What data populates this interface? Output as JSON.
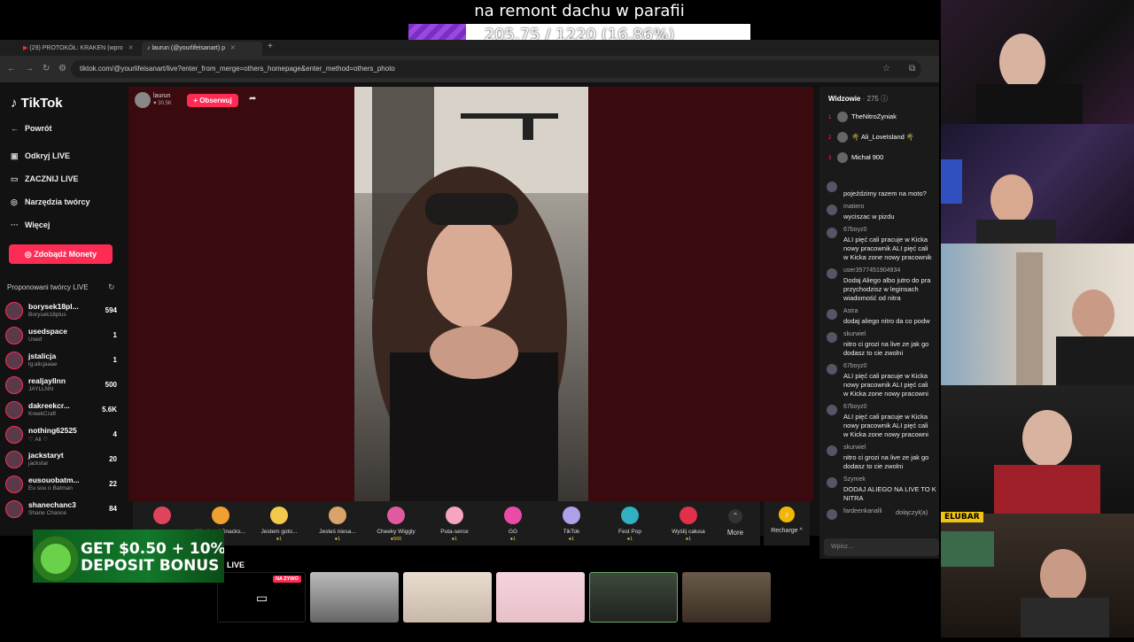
{
  "overlay": {
    "goal_title": "na remont dachu w parafii",
    "goal_text": "205.75 / 1220 (16.86%)",
    "goal_fraction": 0.1686,
    "goal_fill_color": "#8e3fd6"
  },
  "browser": {
    "tabs": [
      "(29) PROTOKÓŁ: KRAKEN (wpro",
      "laurun (@yourlifeisanart) p"
    ],
    "url": "tiktok.com/@yourlifeisanart/live?enter_from_merge=others_homepage&enter_method=others_photo"
  },
  "tiktok": {
    "logo": "TikTok",
    "nav": {
      "back": "Powrót",
      "explore": "Odkryj LIVE",
      "go_live": "ZACZNIJ LIVE",
      "creator_tools": "Narzędzia twórcy",
      "more": "Więcej"
    },
    "get_coins": "Zdobądź Monety",
    "suggested_header": "Proponowani twórcy LIVE",
    "creators": [
      {
        "name": "borysek18pl...",
        "sub": "Borysek18plus",
        "count": "594"
      },
      {
        "name": "usedspace",
        "sub": "Used",
        "count": "1"
      },
      {
        "name": "jstalicja",
        "sub": "lg:alicjaaae",
        "count": "1"
      },
      {
        "name": "realjayllnn",
        "sub": "JAYLLNN",
        "count": "500"
      },
      {
        "name": "dakreekcr...",
        "sub": "KreekCraft",
        "count": "5.6K"
      },
      {
        "name": "nothing62525",
        "sub": "♡ Ali ♡",
        "count": "4"
      },
      {
        "name": "jackstaryt",
        "sub": "jackstar",
        "count": "20"
      },
      {
        "name": "eusouobatm...",
        "sub": "Eu sou o Batman",
        "count": "22"
      },
      {
        "name": "shanechanc3",
        "sub": "Shane Chance",
        "count": "84"
      }
    ],
    "host": {
      "name": "laurun",
      "likes": "30.5K",
      "follow": "+ Obserwuj"
    },
    "gifts": [
      {
        "name": "",
        "price": "1",
        "color": "#e0445a"
      },
      {
        "name": "Weekend Snacks...",
        "price": "1",
        "color": "#f0a030"
      },
      {
        "name": "Jestem goto...",
        "price": "1",
        "color": "#f2c94c"
      },
      {
        "name": "Jesteś niesa...",
        "price": "1",
        "color": "#d9a36b"
      },
      {
        "name": "Cheeky Wiggly",
        "price": "500",
        "color": "#e05aa0"
      },
      {
        "name": "Puta-serce",
        "price": "1",
        "color": "#f5a5c0"
      },
      {
        "name": "GG",
        "price": "1",
        "color": "#e94ba8"
      },
      {
        "name": "TikTok",
        "price": "1",
        "color": "#b0a0e8"
      },
      {
        "name": "Fest Pop",
        "price": "1",
        "color": "#30b0c0"
      },
      {
        "name": "Wyślij całusa",
        "price": "1",
        "color": "#e0304a"
      }
    ],
    "more": "More",
    "recharge": "Recharge ^",
    "viewers_label": "Widzowie",
    "viewers_count": "· 275",
    "top_viewers": [
      {
        "rank": "1",
        "name": "TheNitroZyniak"
      },
      {
        "rank": "2",
        "name": "🌴 Ali_LoveIsland 🌴"
      },
      {
        "rank": "3",
        "name": "Michał 900"
      }
    ],
    "chat": [
      {
        "user": "",
        "text": "pojeździmy razem na moto?"
      },
      {
        "user": "matiero",
        "text": "wyciszac w pizdu"
      },
      {
        "user": "67boyz0",
        "text": "ALI pięć cali pracuje w Kicka\nnowy pracownik ALI pięć cali\nw Kicka zone nowy pracownik"
      },
      {
        "user": "user3577451904934",
        "text": "Dodaj Aliego albo jutro do pra\nprzychodzisz w leginsach\nwiadomość od nitra"
      },
      {
        "user": "Astra",
        "text": "dodaj aliego nitro da co podw"
      },
      {
        "user": "skurwiel",
        "text": "nitro ci grozi na live ze jak go\ndodasz to cie zwolni"
      },
      {
        "user": "67boyz0",
        "text": "ALI pięć cali pracuje w Kicka\nnowy pracownik ALI pięć cali\nw Kicka zone nowy pracowni"
      },
      {
        "user": "67boyz0",
        "text": "ALI pięć cali pracuje w Kicka\nnowy pracownik ALI pięć cali\nw Kicka zone nowy pracowni"
      },
      {
        "user": "skurwiel",
        "text": "nitro ci grozi na live ze jak go\ndodasz to cie zwolni"
      },
      {
        "user": "Szymek",
        "text": "DODAJ ALIEGO NA LIVE TO K\nNITRA"
      },
      {
        "user": "fardeenkanalli",
        "text": "dołączył(a)"
      }
    ],
    "chat_placeholder": "Wpisz...",
    "bottom_label": "LIVE",
    "live_tag": "NA ŻYWO"
  },
  "promo": {
    "line1": "GET $0.50 + 10%",
    "line2": "DEPOSIT BONUS"
  },
  "cam_badge": "ELUBAR"
}
